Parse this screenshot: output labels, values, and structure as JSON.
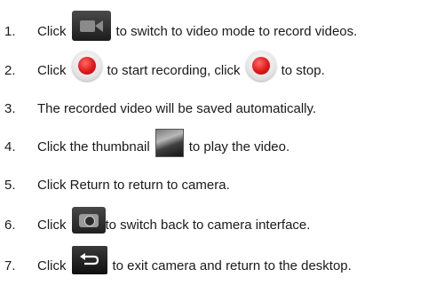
{
  "steps": [
    {
      "num": "1.",
      "pre": "Click",
      "icon": "video-camera-icon",
      "post": "to switch to video mode to record videos."
    },
    {
      "num": "2.",
      "pre": "Click",
      "icon": "record-button-icon",
      "mid": "to start recording, click",
      "icon2": "record-button-icon",
      "post": "to stop."
    },
    {
      "num": "3.",
      "text": "The recorded video will be saved automatically."
    },
    {
      "num": "4.",
      "pre": "Click the thumbnail",
      "icon": "video-thumbnail-icon",
      "post": "to play the video."
    },
    {
      "num": "5.",
      "text": "Click Return to return to camera."
    },
    {
      "num": "6.",
      "pre": "Click",
      "icon": "camera-icon",
      "post": "to switch back to camera interface."
    },
    {
      "num": "7.",
      "pre": "Click",
      "icon": "return-arrow-icon",
      "post": "to exit camera and return to the desktop."
    }
  ]
}
